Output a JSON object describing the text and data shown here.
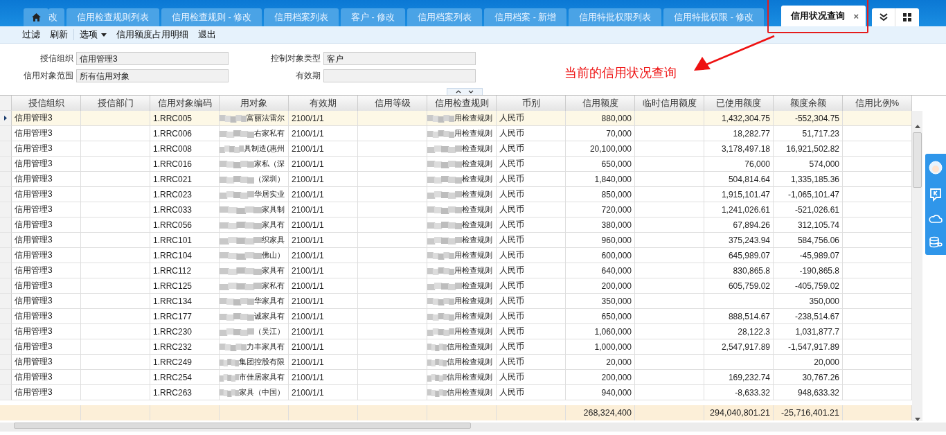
{
  "tabs": [
    {
      "label": "改",
      "selected": false
    },
    {
      "label": "信用检查规则列表",
      "selected": false
    },
    {
      "label": "信用检查规则 - 修改",
      "selected": false
    },
    {
      "label": "信用档案列表",
      "selected": false
    },
    {
      "label": "客户 - 修改",
      "selected": false
    },
    {
      "label": "信用档案列表",
      "selected": false
    },
    {
      "label": "信用档案 - 新增",
      "selected": false
    },
    {
      "label": "信用特批权限列表",
      "selected": false
    },
    {
      "label": "信用特批权限 - 修改",
      "selected": false
    },
    {
      "label": "信用状况查询",
      "selected": true,
      "close": "×"
    }
  ],
  "toolbar": [
    {
      "label": "过滤"
    },
    {
      "label": "刷新"
    },
    {
      "label": "选项",
      "dropdown": true
    },
    {
      "label": "信用额度占用明细"
    },
    {
      "label": "退出"
    }
  ],
  "form": [
    {
      "label": "授信组织",
      "value": "信用管理3"
    },
    {
      "label": "控制对象类型",
      "value": "客户"
    },
    {
      "label": "信用对象范围",
      "value": "所有信用对象"
    },
    {
      "label": "有效期"
    }
  ],
  "annotation": {
    "text": "当前的信用状况查询"
  },
  "table": {
    "columns": [
      "授信组织",
      "授信部门",
      "信用对象编码",
      "用对象",
      "有效期",
      "信用等级",
      "信用检查规则",
      "币别",
      "信用额度",
      "临时信用额度",
      "已使用额度",
      "额度余额",
      "信用比例%"
    ],
    "rows": [
      {
        "selected": true,
        "org": "信用管理3",
        "code": "1.RRC005",
        "object": "富丽法雷尔",
        "expiry": "2100/1/1",
        "rule": "用检查规则",
        "currency": "人民币",
        "limit": "880,000",
        "used": "1,432,304.75",
        "balance": "-552,304.75"
      },
      {
        "selected": false,
        "org": "信用管理3",
        "code": "1.RRC006",
        "object": "右家私有",
        "expiry": "2100/1/1",
        "rule": "用检查规则",
        "currency": "人民币",
        "limit": "70,000",
        "used": "18,282.77",
        "balance": "51,717.23"
      },
      {
        "selected": false,
        "org": "信用管理3",
        "code": "1.RRC008",
        "object": "具制造(惠州",
        "expiry": "2100/1/1",
        "rule": "检查规则",
        "currency": "人民币",
        "limit": "20,100,000",
        "used": "3,178,497.18",
        "balance": "16,921,502.82"
      },
      {
        "selected": false,
        "org": "信用管理3",
        "code": "1.RRC016",
        "object": "家私（深",
        "expiry": "2100/1/1",
        "rule": "检查规则",
        "currency": "人民币",
        "limit": "650,000",
        "used": "76,000",
        "balance": "574,000"
      },
      {
        "selected": false,
        "org": "信用管理3",
        "code": "1.RRC021",
        "object": "（深圳）",
        "expiry": "2100/1/1",
        "rule": "检查规则",
        "currency": "人民币",
        "limit": "1,840,000",
        "used": "504,814.64",
        "balance": "1,335,185.36"
      },
      {
        "selected": false,
        "org": "信用管理3",
        "code": "1.RRC023",
        "object": "华居实业",
        "expiry": "2100/1/1",
        "rule": "检查规则",
        "currency": "人民币",
        "limit": "850,000",
        "used": "1,915,101.47",
        "balance": "-1,065,101.47"
      },
      {
        "selected": false,
        "org": "信用管理3",
        "code": "1.RRC033",
        "object": "家具制",
        "expiry": "2100/1/1",
        "rule": "检查规则",
        "currency": "人民币",
        "limit": "720,000",
        "used": "1,241,026.61",
        "balance": "-521,026.61"
      },
      {
        "selected": false,
        "org": "信用管理3",
        "code": "1.RRC056",
        "object": "家具有",
        "expiry": "2100/1/1",
        "rule": "检查规则",
        "currency": "人民币",
        "limit": "380,000",
        "used": "67,894.26",
        "balance": "312,105.74"
      },
      {
        "selected": false,
        "org": "信用管理3",
        "code": "1.RRC101",
        "object": "织家具",
        "expiry": "2100/1/1",
        "rule": "检查规则",
        "currency": "人民币",
        "limit": "960,000",
        "used": "375,243.94",
        "balance": "584,756.06"
      },
      {
        "selected": false,
        "org": "信用管理3",
        "code": "1.RRC104",
        "object": "佛山）",
        "expiry": "2100/1/1",
        "rule": "用检查规则",
        "currency": "人民币",
        "limit": "600,000",
        "used": "645,989.07",
        "balance": "-45,989.07"
      },
      {
        "selected": false,
        "org": "信用管理3",
        "code": "1.RRC112",
        "object": "家具有",
        "expiry": "2100/1/1",
        "rule": "用检查规则",
        "currency": "人民币",
        "limit": "640,000",
        "used": "830,865.8",
        "balance": "-190,865.8"
      },
      {
        "selected": false,
        "org": "信用管理3",
        "code": "1.RRC125",
        "object": "家私有",
        "expiry": "2100/1/1",
        "rule": "检查规则",
        "currency": "人民币",
        "limit": "200,000",
        "used": "605,759.02",
        "balance": "-405,759.02"
      },
      {
        "selected": false,
        "org": "信用管理3",
        "code": "1.RRC134",
        "object": "华家具有",
        "expiry": "2100/1/1",
        "rule": "用检查规则",
        "currency": "人民币",
        "limit": "350,000",
        "balance": "350,000"
      },
      {
        "selected": false,
        "org": "信用管理3",
        "code": "1.RRC177",
        "object": "诚家具有",
        "expiry": "2100/1/1",
        "rule": "用检查规则",
        "currency": "人民币",
        "limit": "650,000",
        "used": "888,514.67",
        "balance": "-238,514.67"
      },
      {
        "selected": false,
        "org": "信用管理3",
        "code": "1.RRC230",
        "object": "（吴江）",
        "expiry": "2100/1/1",
        "rule": "用检查规则",
        "currency": "人民币",
        "limit": "1,060,000",
        "used": "28,122.3",
        "balance": "1,031,877.7"
      },
      {
        "selected": false,
        "org": "信用管理3",
        "code": "1.RRC232",
        "object": "力丰家具有",
        "expiry": "2100/1/1",
        "rule": "信用检查规则",
        "currency": "人民币",
        "limit": "1,000,000",
        "used": "2,547,917.89",
        "balance": "-1,547,917.89"
      },
      {
        "selected": false,
        "org": "信用管理3",
        "code": "1.RRC249",
        "object": "集团控股有限",
        "expiry": "2100/1/1",
        "rule": "信用检查规则",
        "currency": "人民币",
        "limit": "20,000",
        "balance": "20,000"
      },
      {
        "selected": false,
        "org": "信用管理3",
        "code": "1.RRC254",
        "object": "市佳居家具有",
        "expiry": "2100/1/1",
        "rule": "信用检查规则",
        "currency": "人民币",
        "limit": "200,000",
        "used": "169,232.74",
        "balance": "30,767.26"
      },
      {
        "selected": false,
        "org": "信用管理3",
        "code": "1.RRC263",
        "object": "家具（中国）",
        "expiry": "2100/1/1",
        "rule": "信用检查规则",
        "currency": "人民币",
        "limit": "940,000",
        "used": "-8,633.32",
        "balance": "948,633.32"
      }
    ],
    "totals": {
      "limit": "268,324,400",
      "used": "294,040,801.21",
      "balance": "-25,716,401.21"
    }
  }
}
